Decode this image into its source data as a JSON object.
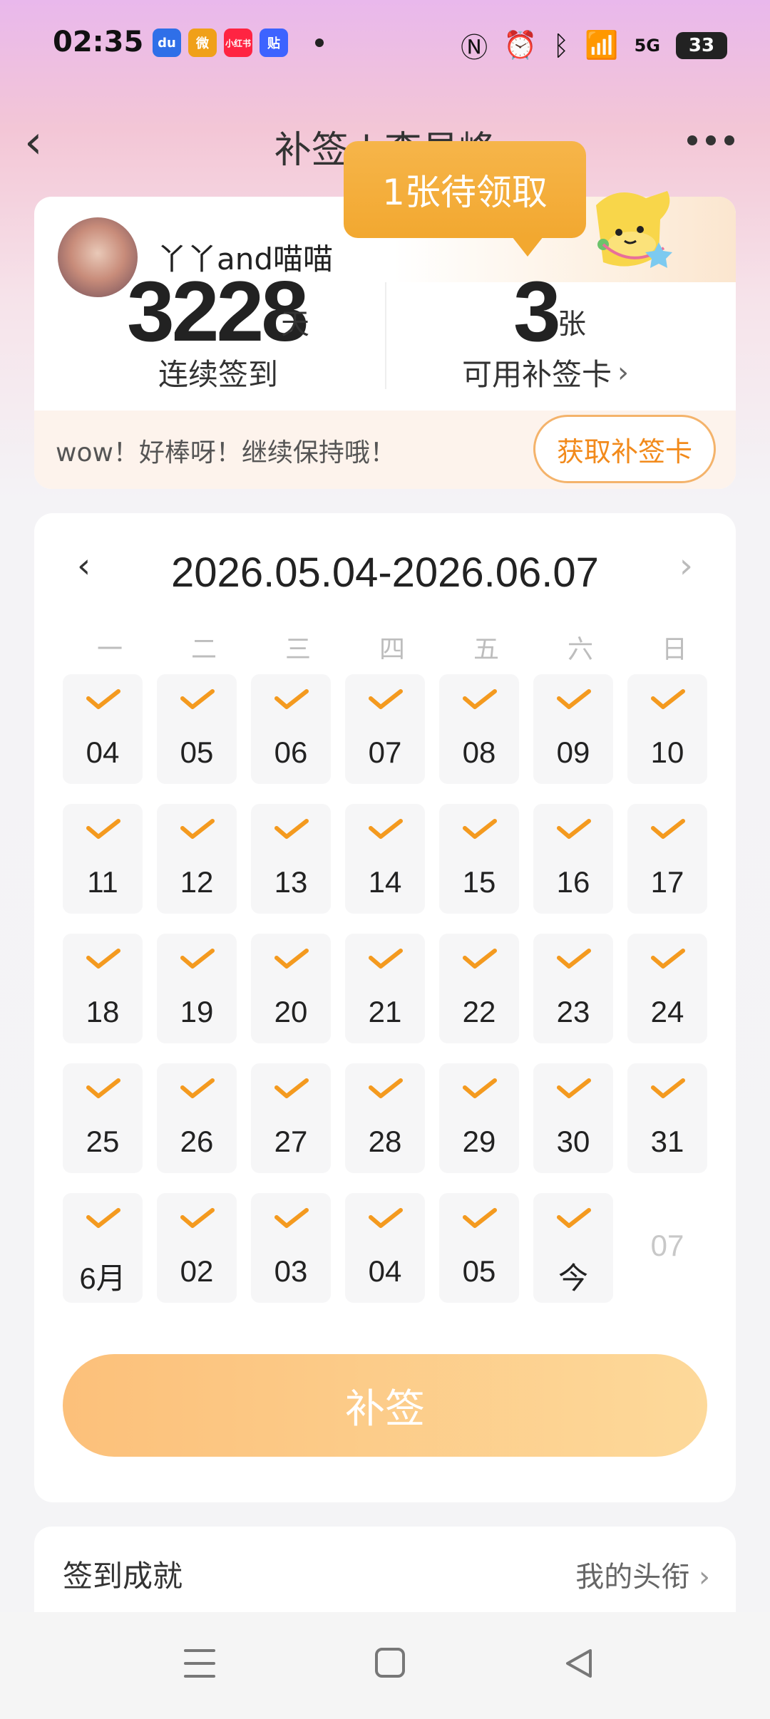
{
  "status_bar": {
    "time": "02:35",
    "apps": [
      {
        "icon": "baidu-icon",
        "label": "du",
        "color": "#2f6fe8"
      },
      {
        "icon": "weibo-icon",
        "label": "微",
        "color": "#f0a019"
      },
      {
        "icon": "xiaohongshu-icon",
        "label": "小红书",
        "color": "#ff2442"
      },
      {
        "icon": "tieba-icon",
        "label": "贴",
        "color": "#3d63ff"
      }
    ],
    "network": "5G",
    "battery": "33"
  },
  "header": {
    "title": "补签 | 李易峰"
  },
  "summary": {
    "username": "丫丫and喵喵",
    "days_value": "3228",
    "days_unit": "天",
    "days_label": "连续签到",
    "cards_value": "3",
    "cards_unit": "张",
    "cards_label": "可用补签卡",
    "bubble": "1张待领取",
    "promo_text": "wow！好棒呀！继续保持哦！",
    "get_card_button": "获取补签卡"
  },
  "calendar": {
    "range": "2026.05.04-2026.06.07",
    "weekdays": [
      "一",
      "二",
      "三",
      "四",
      "五",
      "六",
      "日"
    ],
    "days": [
      {
        "label": "04",
        "checked": true
      },
      {
        "label": "05",
        "checked": true
      },
      {
        "label": "06",
        "checked": true
      },
      {
        "label": "07",
        "checked": true
      },
      {
        "label": "08",
        "checked": true
      },
      {
        "label": "09",
        "checked": true
      },
      {
        "label": "10",
        "checked": true
      },
      {
        "label": "11",
        "checked": true
      },
      {
        "label": "12",
        "checked": true
      },
      {
        "label": "13",
        "checked": true
      },
      {
        "label": "14",
        "checked": true
      },
      {
        "label": "15",
        "checked": true
      },
      {
        "label": "16",
        "checked": true
      },
      {
        "label": "17",
        "checked": true
      },
      {
        "label": "18",
        "checked": true
      },
      {
        "label": "19",
        "checked": true
      },
      {
        "label": "20",
        "checked": true
      },
      {
        "label": "21",
        "checked": true
      },
      {
        "label": "22",
        "checked": true
      },
      {
        "label": "23",
        "checked": true
      },
      {
        "label": "24",
        "checked": true
      },
      {
        "label": "25",
        "checked": true
      },
      {
        "label": "26",
        "checked": true
      },
      {
        "label": "27",
        "checked": true
      },
      {
        "label": "28",
        "checked": true
      },
      {
        "label": "29",
        "checked": true
      },
      {
        "label": "30",
        "checked": true
      },
      {
        "label": "31",
        "checked": true
      },
      {
        "label": "6月",
        "checked": true
      },
      {
        "label": "02",
        "checked": true
      },
      {
        "label": "03",
        "checked": true
      },
      {
        "label": "04",
        "checked": true
      },
      {
        "label": "05",
        "checked": true
      },
      {
        "label": "今",
        "checked": true
      },
      {
        "label": "07",
        "checked": false
      }
    ],
    "makeup_button": "补签"
  },
  "achievements": {
    "title": "签到成就",
    "link": "我的头衔"
  },
  "colors": {
    "accent_orange": "#f28a1b",
    "check_orange": "#f49a1f",
    "bubble_orange": "#f2a830"
  }
}
